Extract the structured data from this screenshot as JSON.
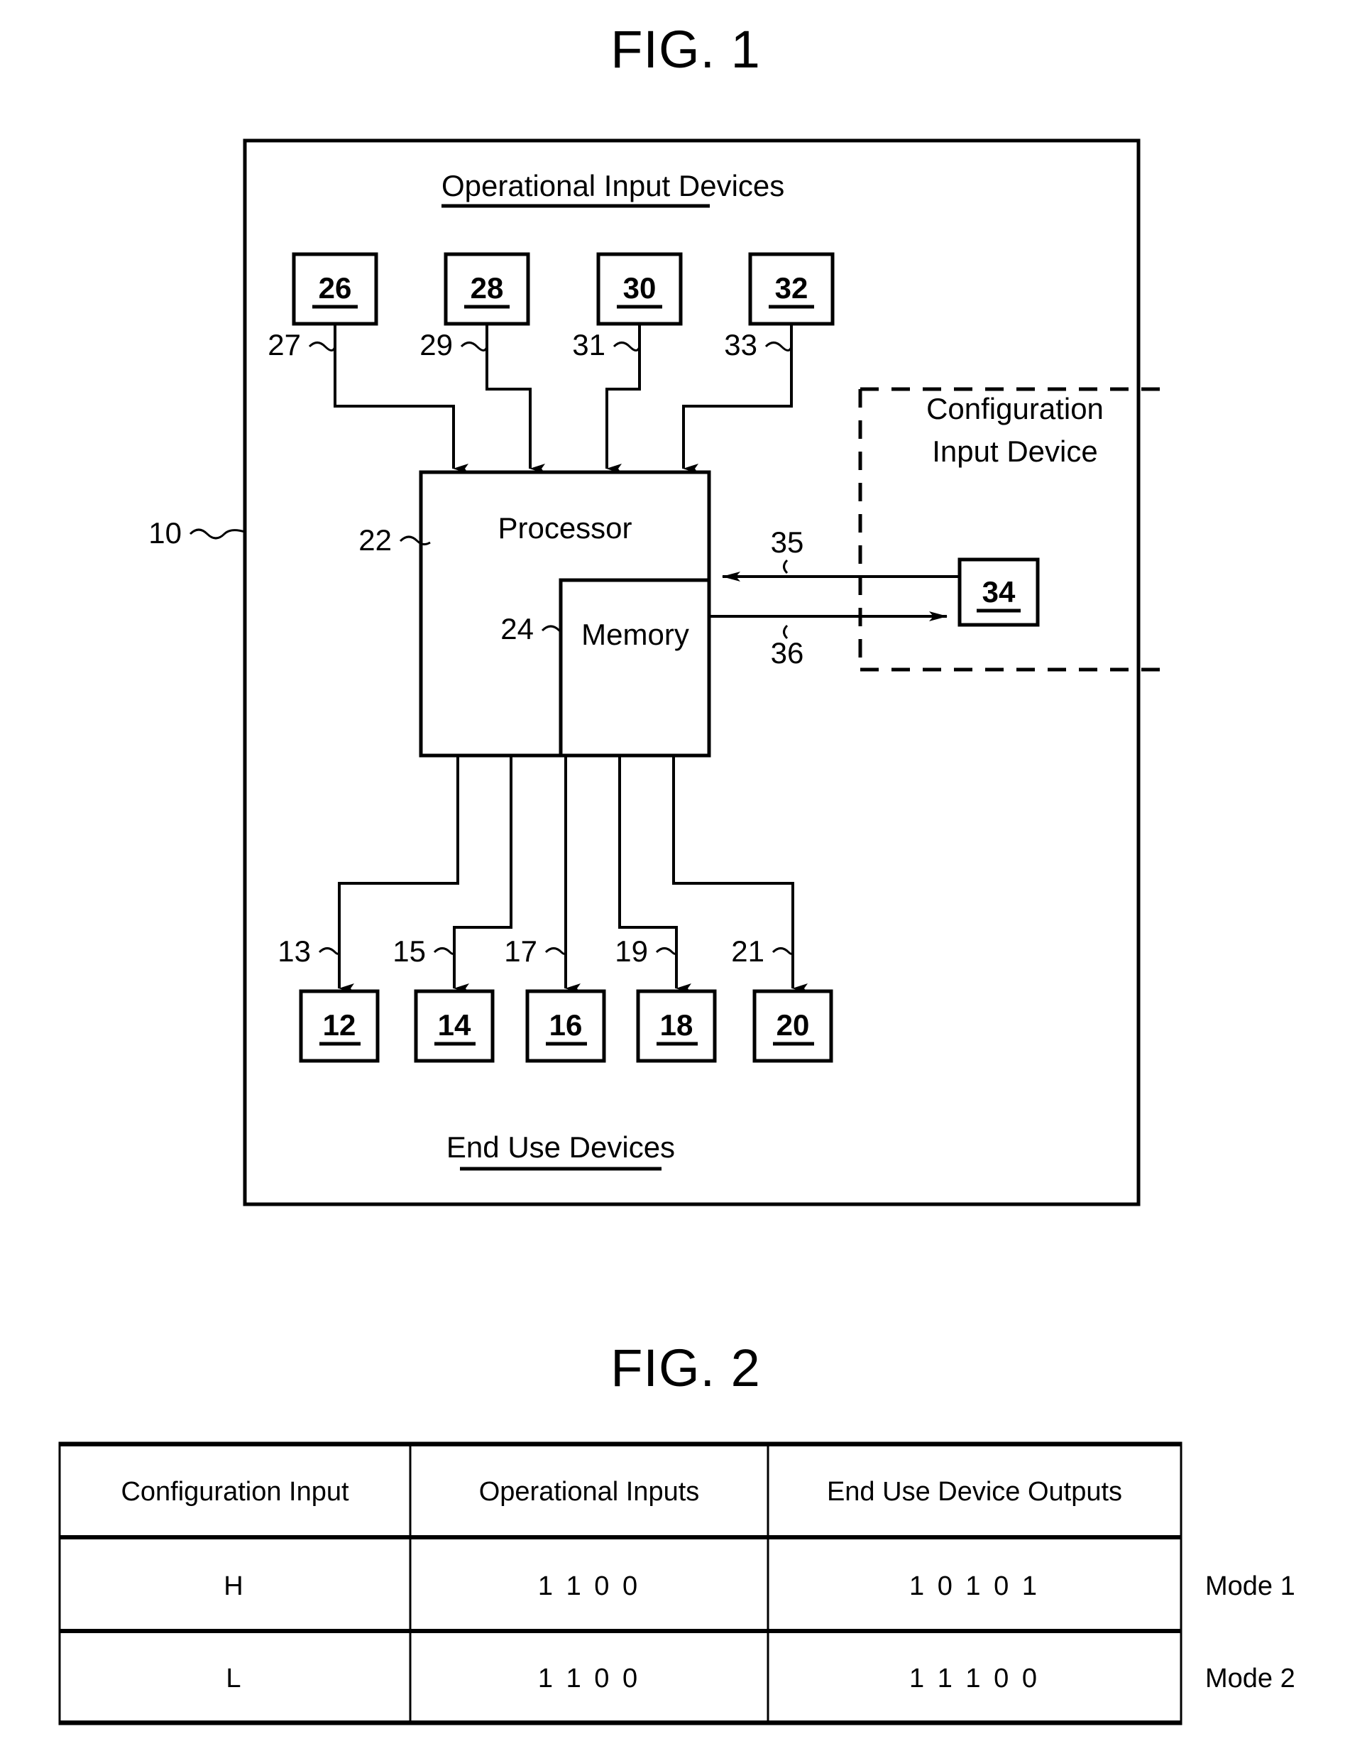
{
  "figures": [
    {
      "id": "fig1",
      "title": "FIG. 1",
      "system_ref": "10",
      "top_section_label": "Operational Input Devices",
      "bottom_section_label": "End Use Devices",
      "processor": {
        "label": "Processor",
        "ref": "22",
        "memory": {
          "label": "Memory",
          "ref": "24"
        }
      },
      "config_group": {
        "label_line1": "Configuration",
        "label_line2": "Input Device",
        "device_ref": "34",
        "line_to_processor_ref": "35",
        "line_from_processor_ref": "36"
      },
      "input_devices": [
        {
          "box": "26",
          "line": "27"
        },
        {
          "box": "28",
          "line": "29"
        },
        {
          "box": "30",
          "line": "31"
        },
        {
          "box": "32",
          "line": "33"
        }
      ],
      "end_use_devices": [
        {
          "box": "12",
          "line": "13"
        },
        {
          "box": "14",
          "line": "15"
        },
        {
          "box": "16",
          "line": "17"
        },
        {
          "box": "18",
          "line": "19"
        },
        {
          "box": "20",
          "line": "21"
        }
      ]
    },
    {
      "id": "fig2",
      "title": "FIG. 2",
      "table": {
        "headers": [
          "Configuration Input",
          "Operational Inputs",
          "End Use Device Outputs"
        ],
        "rows": [
          {
            "cells": [
              "H",
              "1 1 0 0",
              "1 0 1 0 1"
            ],
            "mode": "Mode 1"
          },
          {
            "cells": [
              "L",
              "1 1 0 0",
              "1 1 1 0 0"
            ],
            "mode": "Mode 2"
          }
        ]
      }
    }
  ],
  "colors": {
    "ink": "#000000",
    "paper": "#ffffff"
  }
}
